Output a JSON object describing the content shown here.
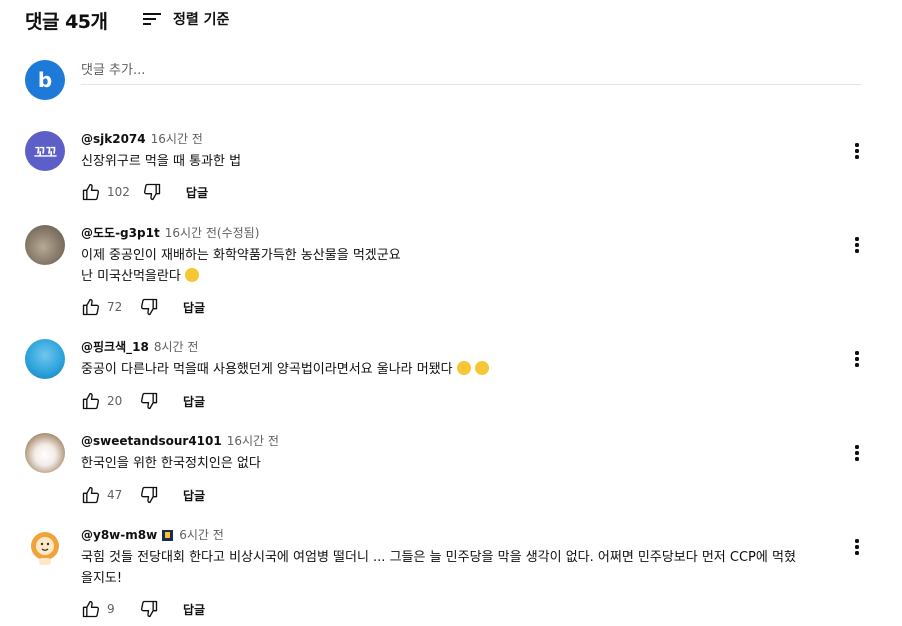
{
  "header": {
    "count_label": "댓글 45개",
    "sort_label": "정렬 기준"
  },
  "add_comment": {
    "avatar_letter": "b",
    "placeholder": "댓글 추가...",
    "avatar_color": "#1e7ad8"
  },
  "actions": {
    "reply_label": "답글"
  },
  "comments": [
    {
      "author": "@sjk2074",
      "time": "16시간 전",
      "lines": [
        "신장위구르 먹을 때 통과한 법"
      ],
      "likes": "102",
      "avatar_text": "꼬꼬"
    },
    {
      "author": "@도도-g3p1t",
      "time": "16시간 전(수정됨)",
      "lines": [
        "이제 중공인이 재배하는 화학약품가득한 농산물을 먹겠군요",
        "난 미국산먹을란다"
      ],
      "likes": "72"
    },
    {
      "author": "@핑크색_18",
      "time": "8시간 전",
      "lines": [
        "중공이 다른나라 먹을때 사용했던게 양곡법이라면서요 울나라 머됐다"
      ],
      "likes": "20"
    },
    {
      "author": "@sweetandsour4101",
      "time": "16시간 전",
      "lines": [
        "한국인을 위한 한국정치인은 없다"
      ],
      "likes": "47"
    },
    {
      "author": "@y8w-m8w",
      "time": "6시간 전",
      "lines": [
        "국힘 것들 전당대회 한다고 비상시국에 여엄병 떨더니 ... 그들은 늘 민주당을 막을 생각이 없다. 어쩌면 민주당보다 먼저 CCP에 먹혔",
        "을지도!"
      ],
      "likes": "9"
    }
  ]
}
